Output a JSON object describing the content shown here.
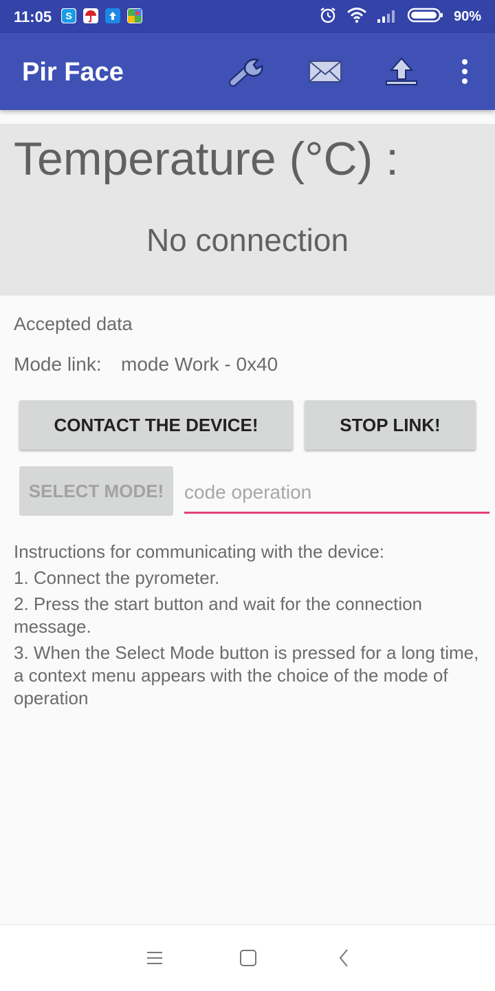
{
  "status_bar": {
    "time": "11:05",
    "battery": "90%",
    "notification_icons": [
      "skype-icon",
      "umbrella-app-icon",
      "upload-app-icon",
      "maps-icon"
    ],
    "system_icons": [
      "alarm-icon",
      "wifi-icon",
      "signal-icon",
      "battery-icon"
    ]
  },
  "app_bar": {
    "title": "Pir Face",
    "actions": [
      "wrench-icon",
      "mail-icon",
      "upload-icon",
      "overflow-menu-icon"
    ]
  },
  "temperature": {
    "label": "Temperature (°C) :",
    "value": "No connection"
  },
  "status": {
    "accepted": "Accepted data",
    "mode_label": "Mode link:",
    "mode_value": "mode Work - 0x40"
  },
  "buttons": {
    "contact": "CONTACT THE DEVICE!",
    "stop": "STOP LINK!",
    "select": "SELECT MODE!"
  },
  "code_input": {
    "placeholder": "code operation",
    "value": ""
  },
  "instructions": {
    "heading": "Instructions for communicating with the device:",
    "step1": "1. Connect the pyrometer.",
    "step2": "2. Press the start button and wait for the connection message.",
    "step3": "3. When the Select Mode button is pressed for a long time, a context menu appears with the choice of the mode of operation"
  },
  "colors": {
    "app_bar": "#3f51b5",
    "status_bar": "#3343a8",
    "accent": "#e7407a"
  }
}
